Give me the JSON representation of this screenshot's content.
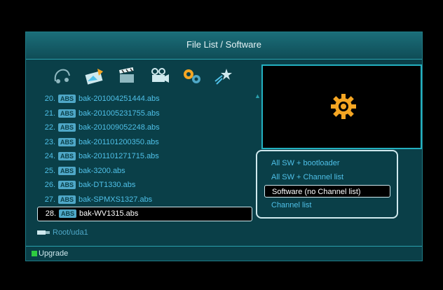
{
  "window": {
    "title": "File List / Software"
  },
  "toolbar": {
    "icons": [
      "music-icon",
      "picture-icon",
      "clapper-icon",
      "camera-icon",
      "settings-gears-icon",
      "star-icon"
    ]
  },
  "files": [
    {
      "num": "20.",
      "badge": "ABS",
      "name": "bak-201004251444.abs"
    },
    {
      "num": "21.",
      "badge": "ABS",
      "name": "bak-201005231755.abs"
    },
    {
      "num": "22.",
      "badge": "ABS",
      "name": "bak-201009052248.abs"
    },
    {
      "num": "23.",
      "badge": "ABS",
      "name": "bak-201101200350.abs"
    },
    {
      "num": "24.",
      "badge": "ABS",
      "name": "bak-201101271715.abs"
    },
    {
      "num": "25.",
      "badge": "ABS",
      "name": "bak-3200.abs"
    },
    {
      "num": "26.",
      "badge": "ABS",
      "name": "bak-DT1330.abs"
    },
    {
      "num": "27.",
      "badge": "ABS",
      "name": "bak-SPMXS1327.abs"
    },
    {
      "num": "28.",
      "badge": "ABS",
      "name": "bak-WV1315.abs"
    }
  ],
  "popup": {
    "options": [
      "All SW + bootloader",
      "All SW + Channel list",
      "Software (no Channel list)",
      "Channel list"
    ]
  },
  "path": "Root/uda1",
  "footer": {
    "green_label": "Upgrade"
  },
  "colors": {
    "panel": "#0a3f48",
    "accent": "#23b0c0",
    "text": "#4fc0e8",
    "gear": "#f5a623",
    "green": "#2ecc40"
  }
}
